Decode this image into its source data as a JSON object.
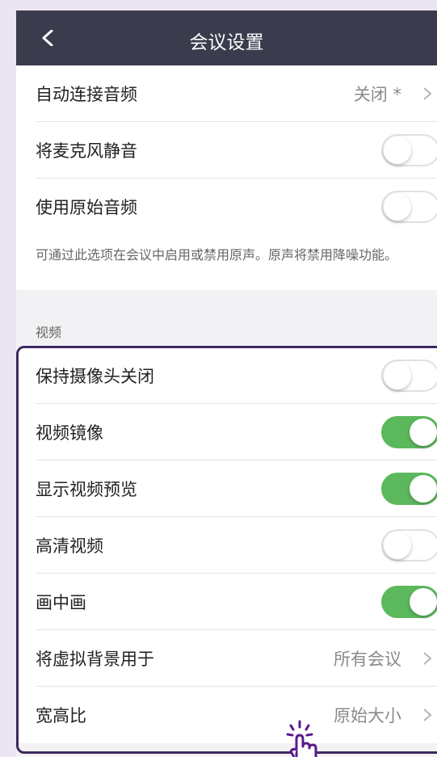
{
  "header": {
    "title": "会议设置",
    "back_icon": "chevron-left-icon"
  },
  "audio": [
    {
      "label": "自动连接音频",
      "value": "关闭 *",
      "control": "chevron"
    },
    {
      "label": "将麦克风静音",
      "toggle": false
    },
    {
      "label": "使用原始音频",
      "toggle": false
    }
  ],
  "note": "可通过此选项在会议中启用或禁用原声。原声将禁用降噪功能。",
  "video": {
    "section_title": "视频",
    "rows": [
      {
        "label": "保持摄像头关闭",
        "toggle": false
      },
      {
        "label": "视频镜像",
        "toggle": true
      },
      {
        "label": "显示视频预览",
        "toggle": true
      },
      {
        "label": "高清视频",
        "toggle": false
      },
      {
        "label": "画中画",
        "toggle": true
      },
      {
        "label": "将虚拟背景用于",
        "value": "所有会议",
        "control": "chevron"
      },
      {
        "label": "宽高比",
        "value": "原始大小",
        "control": "chevron"
      }
    ]
  },
  "colors": {
    "header": "#3a3b4d",
    "toggle_on": "#5cb85c",
    "highlight": "#3d2a5e"
  },
  "cursor_icon": "hand-pointer-icon"
}
